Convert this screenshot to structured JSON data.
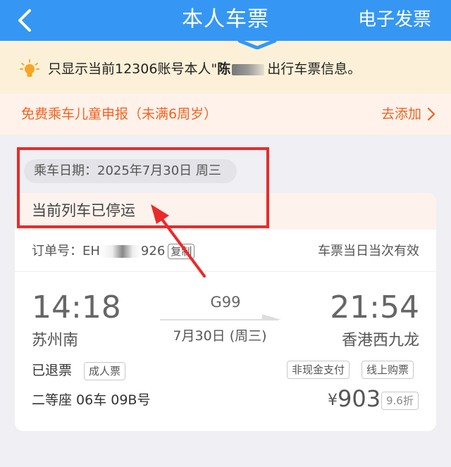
{
  "header": {
    "title": "本人车票",
    "right_action": "电子发票"
  },
  "notice": {
    "prefix": "只显示当前12306账号本人\"",
    "name_visible": "陈",
    "suffix": "出行车票信息。"
  },
  "kids_banner": {
    "text": "免费乘车儿童申报（未满6周岁）",
    "action": "去添加"
  },
  "ticket": {
    "date_label": "乘车日期：2025年7月30日 周三",
    "status": "当前列车已停运",
    "order_prefix": "订单号：EH",
    "order_suffix": "926",
    "copy_label": "复制",
    "validity": "车票当日当次有效",
    "departure_time": "14:18",
    "departure_station": "苏州南",
    "arrival_time": "21:54",
    "arrival_station": "香港西九龙",
    "train_number": "G99",
    "train_date": "7月30日 (周三)",
    "ticket_status": "已退票",
    "ticket_type": "成人票",
    "payment_tag": "非现金支付",
    "purchase_tag": "线上购票",
    "seat": "二等座 06车 09B号",
    "currency": "¥",
    "price": "903",
    "discount": "9.6折"
  },
  "colors": {
    "header_bg": "#3597f3",
    "accent_orange": "#f06322",
    "annotation_red": "#ea2a2a"
  }
}
